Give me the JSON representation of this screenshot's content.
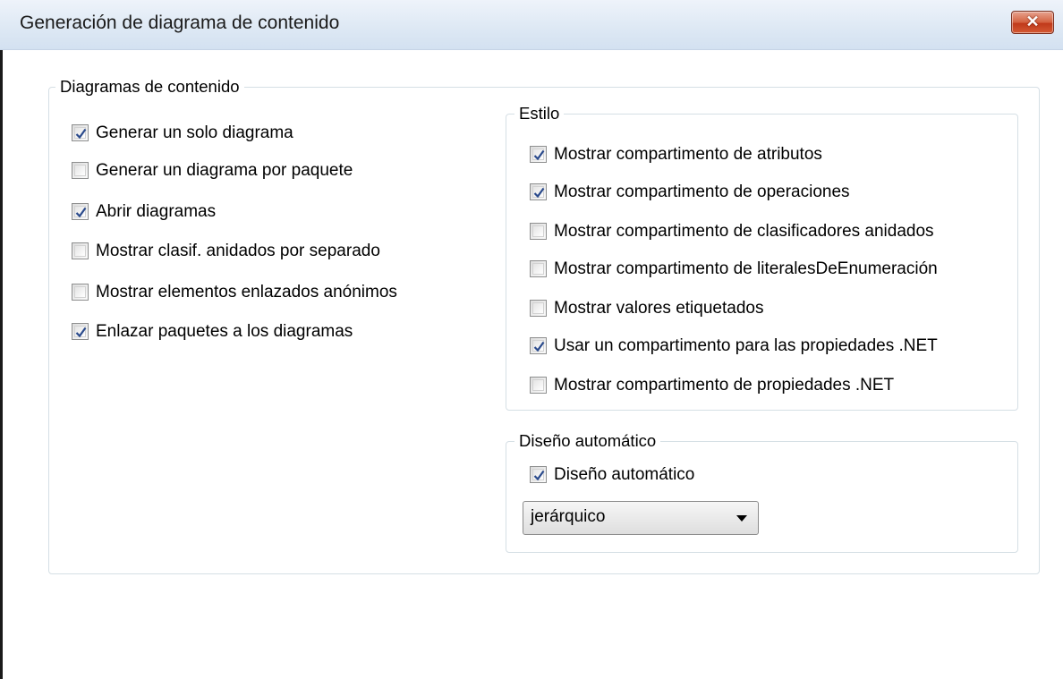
{
  "window": {
    "title": "Generación de diagrama de contenido",
    "close_label": "✕"
  },
  "content_diagrams": {
    "legend": "Diagramas de contenido",
    "options": [
      {
        "label": "Generar un solo diagrama",
        "checked": true
      },
      {
        "label": "Generar un diagrama por paquete",
        "checked": false
      },
      {
        "label": "Abrir diagramas",
        "checked": true
      },
      {
        "label": "Mostrar clasif. anidados por separado",
        "checked": false
      },
      {
        "label": "Mostrar elementos enlazados anónimos",
        "checked": false
      },
      {
        "label": "Enlazar paquetes a los diagramas",
        "checked": true
      }
    ]
  },
  "style": {
    "legend": "Estilo",
    "options": [
      {
        "label": "Mostrar compartimento de atributos",
        "checked": true
      },
      {
        "label": "Mostrar compartimento de operaciones",
        "checked": true
      },
      {
        "label": "Mostrar compartimento de clasificadores anidados",
        "checked": false
      },
      {
        "label": "Mostrar compartimento de literalesDeEnumeración",
        "checked": false
      },
      {
        "label": "Mostrar valores etiquetados",
        "checked": false
      },
      {
        "label": "Usar un compartimento para las propiedades .NET",
        "checked": true
      },
      {
        "label": "Mostrar compartimento de propiedades .NET",
        "checked": false
      }
    ]
  },
  "auto_layout": {
    "legend": "Diseño automático",
    "checkbox": {
      "label": "Diseño automático",
      "checked": true
    },
    "select_value": "jerárquico"
  },
  "colors": {
    "titlebar": "#dde8f4",
    "close_button": "#c7432a",
    "check_mark": "#2a4a8c",
    "group_border": "#d5dfe5"
  }
}
